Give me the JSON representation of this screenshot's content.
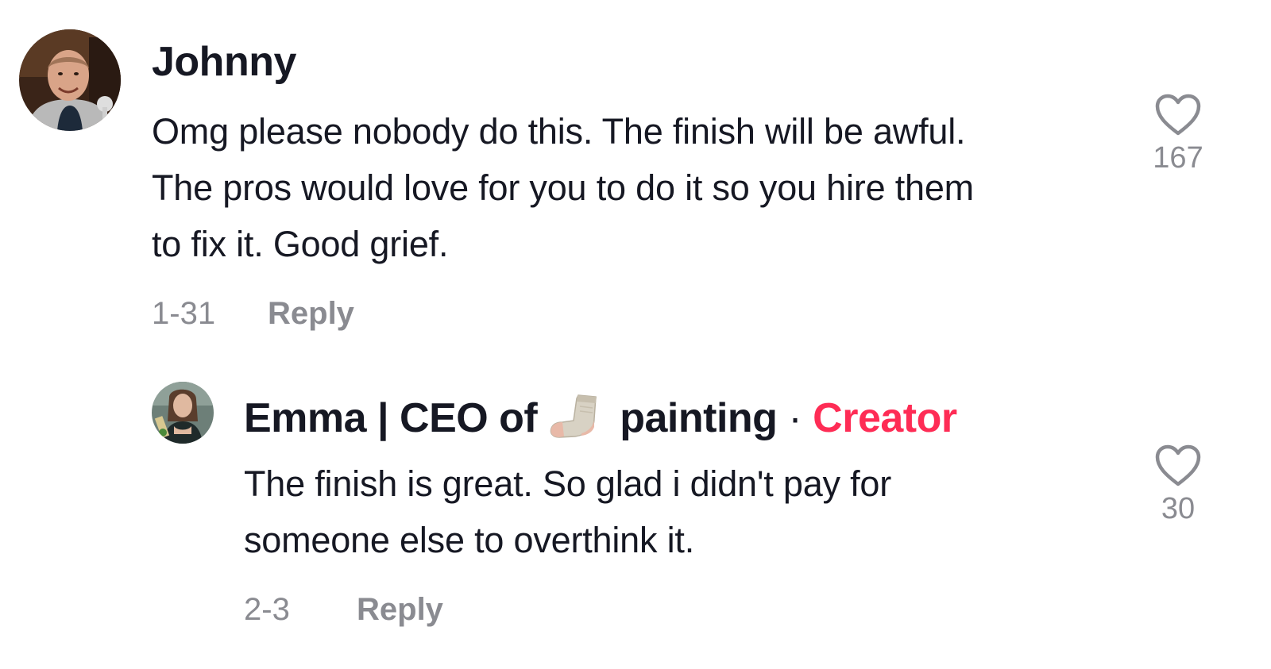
{
  "comments": [
    {
      "username": "Johnny",
      "text_lines": [
        "Omg please nobody do this. The finish will be awful.",
        "The pros would love for you to do it so you hire them",
        "to fix it. Good grief."
      ],
      "date": "1-31",
      "reply_label": "Reply",
      "likes": "167",
      "avatar_icon": "profile-photo"
    }
  ],
  "replies": [
    {
      "username_prefix": "Emma | CEO of",
      "username_emoji": "sock-emoji",
      "username_suffix": "painting",
      "separator": "·",
      "creator_label": "Creator",
      "text_lines": [
        "The finish is great. So glad i didn't pay for",
        "someone else to overthink it."
      ],
      "date": "2-3",
      "reply_label": "Reply",
      "likes": "30",
      "avatar_icon": "profile-photo"
    }
  ],
  "colors": {
    "text": "#161823",
    "muted": "#8a8b91",
    "creator": "#fe2c55",
    "background": "#ffffff"
  }
}
